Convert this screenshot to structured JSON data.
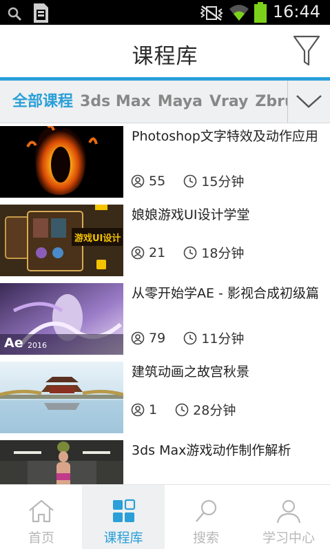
{
  "status_bar": {
    "time": "16:44"
  },
  "header": {
    "title": "课程库"
  },
  "categories": {
    "items": [
      "全部课程",
      "3ds Max",
      "Maya",
      "Vray",
      "Zbrus"
    ],
    "active_index": 0
  },
  "courses": [
    {
      "title": "Photoshop文字特效及动作应用",
      "students": "55",
      "duration": "15分钟"
    },
    {
      "title": "娘娘游戏UI设计学堂",
      "students": "21",
      "duration": "18分钟"
    },
    {
      "title": "从零开始学AE - 影视合成初级篇",
      "students": "79",
      "duration": "11分钟",
      "thumb_text": "Ae",
      "thumb_year": "2016"
    },
    {
      "title": "建筑动画之故宫秋景",
      "students": "1",
      "duration": "28分钟"
    },
    {
      "title": "3ds Max游戏动作制作解析"
    }
  ],
  "thumb2_text": "游戏UI设计",
  "bottom_nav": [
    {
      "label": "首页",
      "icon": "home-icon"
    },
    {
      "label": "课程库",
      "icon": "grid-icon"
    },
    {
      "label": "搜索",
      "icon": "search-icon"
    },
    {
      "label": "学习中心",
      "icon": "user-icon"
    }
  ],
  "colors": {
    "accent": "#2a9fd8",
    "status_bar": "#000000",
    "battery": "#7cd11a",
    "inactive_nav": "#b8b8b8"
  }
}
